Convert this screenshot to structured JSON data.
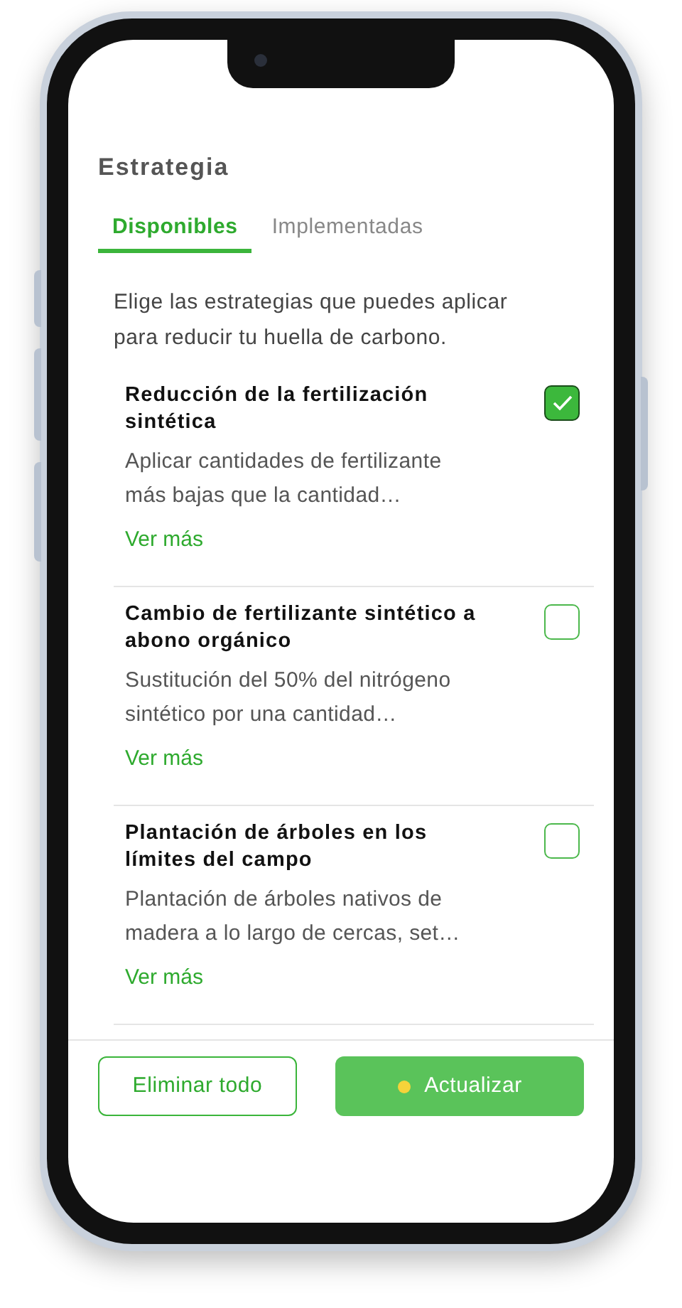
{
  "title": "Estrategia",
  "tabs": [
    {
      "label": "Disponibles",
      "selected": true
    },
    {
      "label": "Implementadas",
      "selected": false
    }
  ],
  "intro": "Elige las estrategias que puedes aplicar para reducir tu huella de carbono.",
  "strategies": [
    {
      "title": "Reducción de la fertilización sintética",
      "description": "Aplicar cantidades de fertilizante más bajas que la cantidad…",
      "link": "Ver más",
      "checked": true
    },
    {
      "title": "Cambio de fertilizante sintético a abono orgánico",
      "description": "Sustitución del 50% del nitrógeno sintético por una cantidad…",
      "link": "Ver más",
      "checked": false
    },
    {
      "title": "Plantación de árboles en los límites del campo",
      "description": "Plantación de árboles nativos de madera a lo largo de cercas, set…",
      "link": "Ver más",
      "checked": false
    }
  ],
  "buttons": [
    {
      "label": "Eliminar todo",
      "kind": "outline"
    },
    {
      "label": "Actualizar",
      "kind": "primary"
    }
  ]
}
